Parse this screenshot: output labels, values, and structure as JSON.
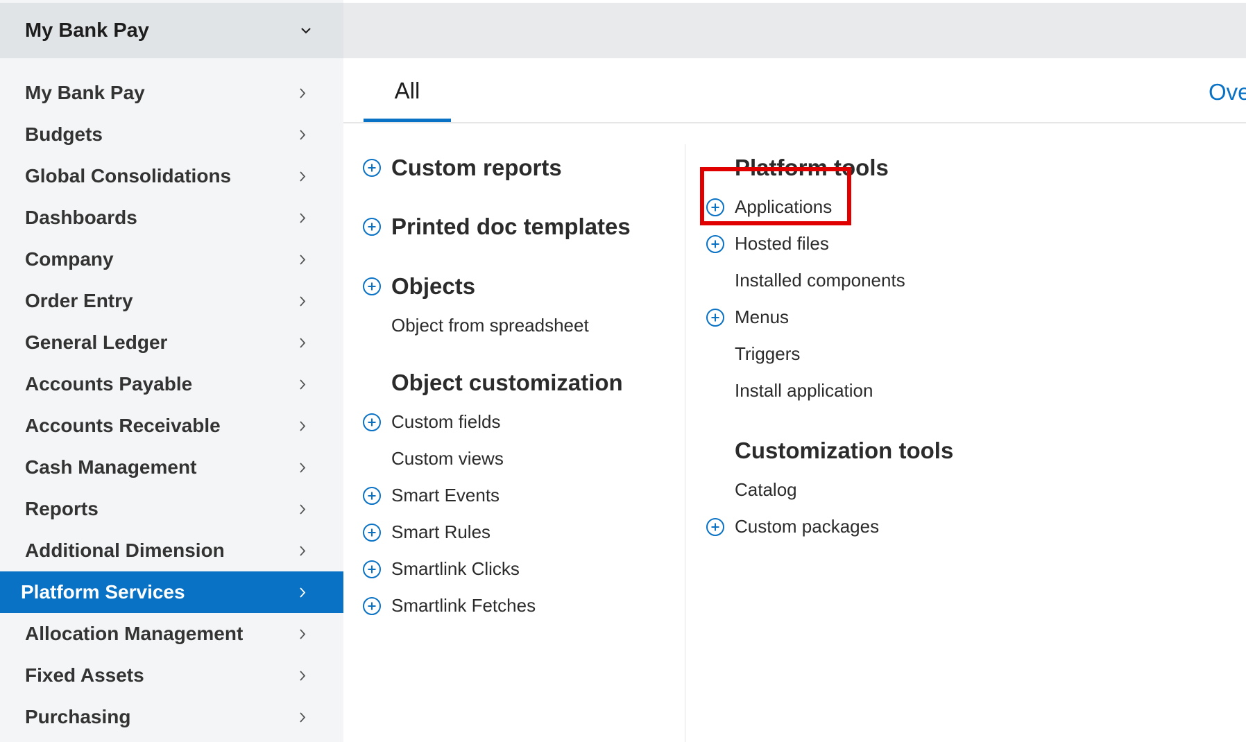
{
  "sidebar": {
    "header_title": "My Bank Pay",
    "items": [
      {
        "label": "My Bank Pay"
      },
      {
        "label": "Budgets"
      },
      {
        "label": "Global Consolidations"
      },
      {
        "label": "Dashboards"
      },
      {
        "label": "Company"
      },
      {
        "label": "Order Entry"
      },
      {
        "label": "General Ledger"
      },
      {
        "label": "Accounts Payable"
      },
      {
        "label": "Accounts Receivable"
      },
      {
        "label": "Cash Management"
      },
      {
        "label": "Reports"
      },
      {
        "label": "Additional Dimension"
      },
      {
        "label": "Platform Services"
      },
      {
        "label": "Allocation Management"
      },
      {
        "label": "Fixed Assets"
      },
      {
        "label": "Purchasing"
      }
    ]
  },
  "tabs": {
    "all": "All",
    "overview": "Ove"
  },
  "left_column": {
    "custom_reports": "Custom reports",
    "printed_doc_templates": "Printed doc templates",
    "objects": "Objects",
    "object_from_spreadsheet": "Object from spreadsheet",
    "object_customization": "Object customization",
    "custom_fields": "Custom fields",
    "custom_views": "Custom views",
    "smart_events": "Smart Events",
    "smart_rules": "Smart Rules",
    "smartlink_clicks": "Smartlink Clicks",
    "smartlink_fetches": "Smartlink Fetches"
  },
  "right_column": {
    "platform_tools": "Platform tools",
    "applications": "Applications",
    "hosted_files": "Hosted files",
    "installed_components": "Installed components",
    "menus": "Menus",
    "triggers": "Triggers",
    "install_application": "Install application",
    "customization_tools": "Customization tools",
    "catalog": "Catalog",
    "custom_packages": "Custom packages"
  },
  "colors": {
    "accent": "#0a72c5",
    "highlight": "#e00000",
    "sidebar_bg": "#f4f5f6"
  }
}
